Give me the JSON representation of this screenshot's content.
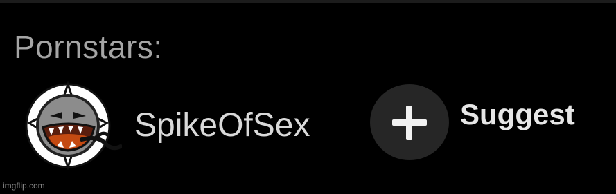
{
  "section": {
    "label": "Pornstars:"
  },
  "pornstars": [
    {
      "name": "SpikeOfSex",
      "avatar_icon": "spiked-ball-monster-icon"
    }
  ],
  "suggest": {
    "label": "Suggest",
    "icon": "plus-icon"
  },
  "watermark": "imgflip.com"
}
